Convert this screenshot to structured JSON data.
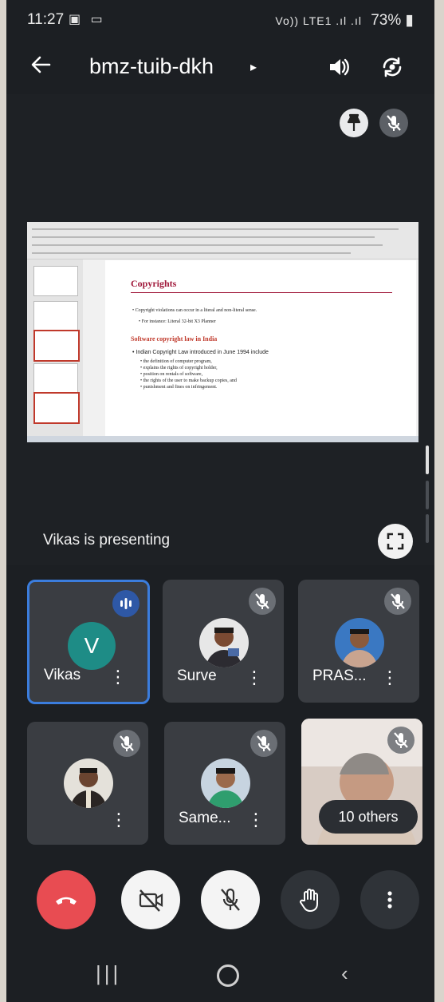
{
  "status_bar": {
    "time": "11:27",
    "left_icons": "▣ ▭",
    "signal": "Vo)) LTE1 .ıl .ıl",
    "battery": "73%"
  },
  "header": {
    "back_icon": "arrow-left-icon",
    "meeting_code": "bmz-tuib-dkh",
    "caret": "▸",
    "speaker_icon": "speaker-icon",
    "switch_camera_icon": "switch-camera-icon"
  },
  "presentation": {
    "slide": {
      "title": "Copyrights",
      "bullet1": "• Copyright violations can occur in a literal and non-literal sense.",
      "bullet1_sub": "• For instance: Literal 32-bit X3 Planner",
      "subtitle": "Software copyright law in India",
      "body_intro": "• Indian Copyright Law introduced in June 1994 include",
      "body_items": [
        "• the definition of computer program,",
        "• explains the rights of copyright holder,",
        "• position on rentals of software,",
        "• the rights of the user to make backup copies, and",
        "• punishment and fines on infringement."
      ]
    },
    "presenting_label": "Vikas is presenting"
  },
  "participants": [
    {
      "name": "Vikas",
      "initial": "V",
      "state": "speaking"
    },
    {
      "name": "Surve",
      "state": "muted"
    },
    {
      "name": "PRAS...",
      "state": "muted"
    },
    {
      "name": "",
      "state": "muted"
    },
    {
      "name": "Same...",
      "state": "muted"
    },
    {
      "name": "",
      "state": "muted",
      "others_label": "10 others"
    }
  ],
  "controls": {
    "end_call": "end-call-icon",
    "camera": "camera-off-icon",
    "mic": "mic-off-icon",
    "hand": "raise-hand-icon",
    "more": "more-vert-icon"
  },
  "colors": {
    "end_call": "#e84c52",
    "active_border": "#3b7ddd",
    "avatar_v": "#1e8c86",
    "tile_bg": "#3a3d42"
  }
}
